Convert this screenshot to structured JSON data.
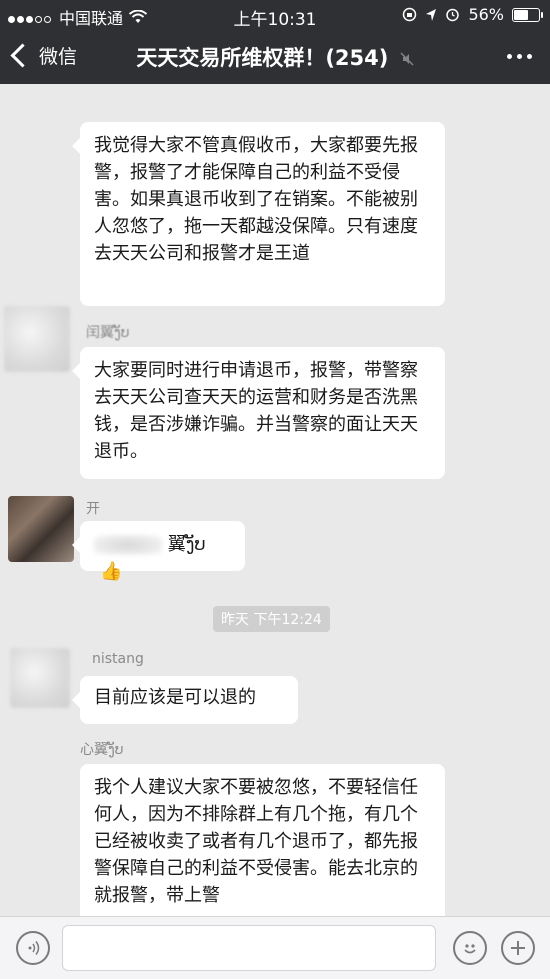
{
  "status_bar": {
    "carrier": "中国联通",
    "time": "上午10:31",
    "battery": "56%"
  },
  "nav": {
    "back_label": "微信",
    "title": "天天交易所维权群！(254)"
  },
  "messages": [
    {
      "sender": "",
      "text": "我觉得大家不管真假收币，大家都要先报警，报警了才能保障自己的利益不受侵害。如果真退币收到了在销案。不能被别人忽悠了，拖一天都越没保障。只有速度去天天公司和报警才是王道"
    },
    {
      "sender": "闰翼ງັບ",
      "text": "大家要同时进行申请退币，报警，带警察去天天公司查天天的运营和财务是否洗黑钱，是否涉嫌诈骗。并当警察的面让天天退币。"
    },
    {
      "sender": "开",
      "text": "翼ງັບ",
      "emoji": "👍"
    },
    {
      "sender": "nistang",
      "text": "目前应该是可以退的"
    },
    {
      "sender": "心翼ງັບ",
      "text": "我个人建议大家不要被忽悠，不要轻信任何人，因为不排除群上有几个拖，有几个已经被收卖了或者有几个退币了，都先报警保障自己的利益不受侵害。能去北京的就报警，带上警"
    }
  ],
  "timestamp": "昨天 下午12:24",
  "input": {
    "placeholder": ""
  },
  "icons": {
    "voice": "voice-icon",
    "emoji": "emoji-icon",
    "add": "plus-icon"
  }
}
